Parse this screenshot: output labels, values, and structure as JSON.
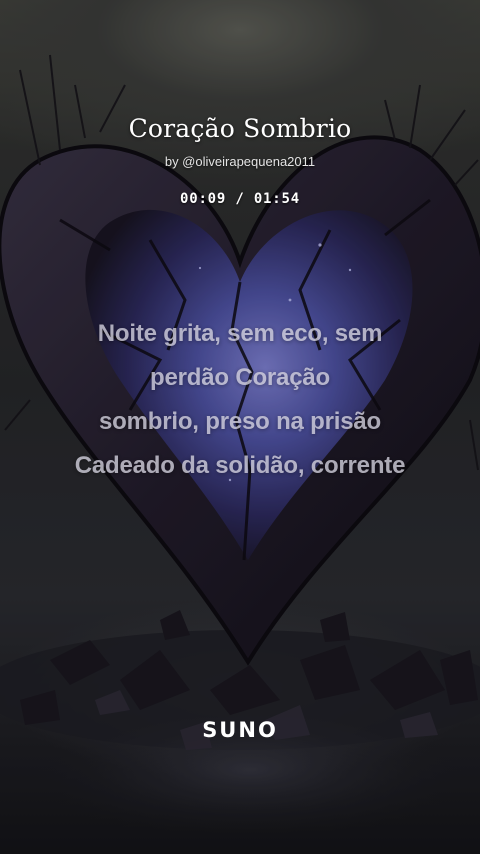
{
  "song": {
    "title": "Coração Sombrio",
    "byline": "by @oliveirapequena2011"
  },
  "player": {
    "time_display": "00:09 / 01:54"
  },
  "lyrics": {
    "lines": [
      "Noite grita, sem eco, sem",
      "perdão Coração",
      "sombrio, preso na prisão",
      "Cadeado da solidão, corrente"
    ]
  },
  "brand": {
    "logo_text": "SUNO"
  },
  "artwork": {
    "icon": "broken-heart-icon",
    "colors": {
      "heart_core": "#4a4f9a",
      "heart_glow": "#6e6fc4",
      "heart_shell": "#1e1a24",
      "background_top": "#45463f",
      "background_bottom": "#141418"
    }
  }
}
